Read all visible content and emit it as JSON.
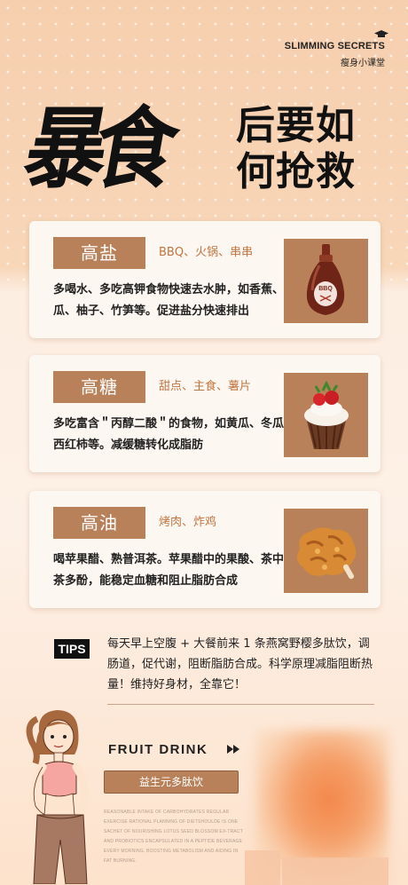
{
  "brand": {
    "title": "SLIMMING SECRETS",
    "subtitle": "瘦身小课堂"
  },
  "hero": {
    "big": "暴食",
    "line1": "后要如",
    "line2": "何抢救"
  },
  "cards": [
    {
      "tag": "高盐",
      "subtitle": "BBQ、火锅、串串",
      "body": "多喝水、多吃高钾食物快速去水肿，如香蕉、西瓜、柚子、竹笋等。促进盐分快速排出",
      "image_label": "BBQ"
    },
    {
      "tag": "高糖",
      "subtitle": "甜点、主食、薯片",
      "body": "多吃富含＂丙醇二酸＂的食物，如黄瓜、冬瓜、西红柿等。减缓糖转化成脂肪"
    },
    {
      "tag": "高油",
      "subtitle": "烤肉、炸鸡",
      "body": "喝苹果醋、熟普洱茶。苹果醋中的果酸、茶中的茶多酚，能稳定血糖和阻止脂肪合成"
    }
  ],
  "tips": {
    "label": "TIPS",
    "text": "每天早上空腹 + 大餐前来 1 条燕窝野樱多肽饮，调肠道，促代谢，阻断脂肪合成。科学原理减脂阻断热量！维持好身材，全靠它！"
  },
  "product": {
    "title": "FRUIT DRINK",
    "button": "益生元多肽饮",
    "fine_print": "REASONABLE INTAKE OF CARBOHYDRATES REGULAR EXERCISE RATIONAL PLANNING OF DIETSHOULDE IS ONE SACHET OF NOURISHING LOTUS SEED BLOSSOM EX-TRACT AND PROBIOTICS ENCAPSULATED IN A PEPTIDE BEVERAGE EVERY MORNING, BOOSTING METABOLISM AND AIDING IN FAT BURNING."
  },
  "colors": {
    "accent": "#b9815a",
    "background": "#f8d6b8",
    "text": "#222222",
    "orange": "#f3874a"
  }
}
